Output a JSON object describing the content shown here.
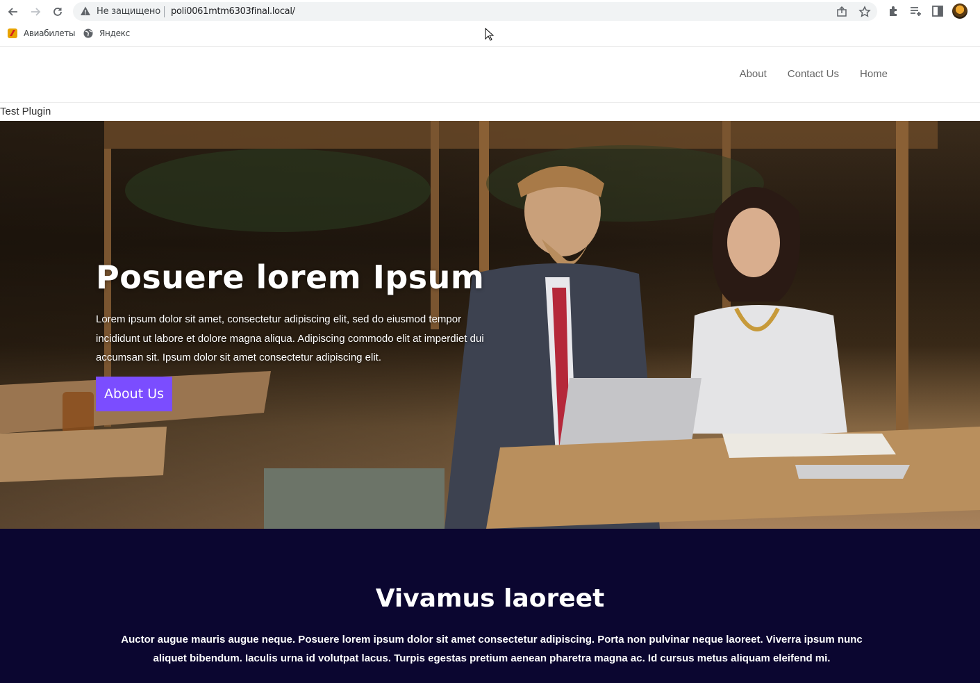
{
  "browser": {
    "security_label": "Не защищено",
    "url": "poli0061mtm6303final.local/",
    "bookmarks": [
      {
        "label": "Авиабилеты",
        "icon": "bookmark-app-icon"
      },
      {
        "label": "Яндекс",
        "icon": "globe-icon"
      }
    ]
  },
  "site": {
    "nav": [
      "About",
      "Contact Us",
      "Home"
    ],
    "plugin_text": "Test Plugin"
  },
  "hero": {
    "title": "Posuere lorem Ipsum",
    "text": "Lorem ipsum dolor sit amet, consectetur adipiscing elit, sed do eiusmod tempor incididunt ut labore et dolore magna aliqua. Adipiscing commodo elit at imperdiet dui accumsan sit. Ipsum dolor sit amet consectetur adipiscing elit.",
    "button": "About Us",
    "button_color": "#7b4dff"
  },
  "section": {
    "title": "Vivamus laoreet",
    "text": "Auctor augue mauris augue neque. Posuere lorem ipsum dolor sit amet consectetur adipiscing. Porta non pulvinar neque laoreet. Viverra ipsum nunc aliquet bibendum. Iaculis urna id volutpat lacus. Turpis egestas pretium aenean pharetra magna ac. Id cursus metus aliquam eleifend mi.",
    "background": "#0b0630"
  }
}
